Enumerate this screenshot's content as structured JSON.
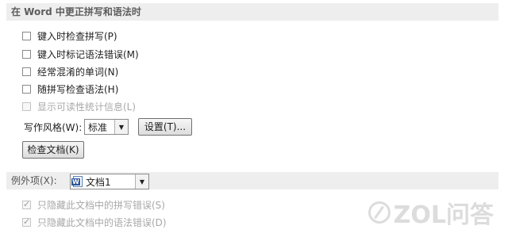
{
  "grammar_section": {
    "title": "在 Word 中更正拼写和语法时",
    "options": [
      {
        "label": "键入时检查拼写(P)",
        "checked": false,
        "disabled": false
      },
      {
        "label": "键入时标记语法错误(M)",
        "checked": false,
        "disabled": false
      },
      {
        "label": "经常混淆的单词(N)",
        "checked": false,
        "disabled": false
      },
      {
        "label": "随拼写检查语法(H)",
        "checked": false,
        "disabled": false
      },
      {
        "label": "显示可读性统计信息(L)",
        "checked": false,
        "disabled": true
      }
    ],
    "writing_style_label": "写作风格(W):",
    "writing_style_value": "标准",
    "settings_button": "设置(T)...",
    "check_document_button": "检查文档(K)"
  },
  "exceptions_section": {
    "title": "例外项(X):",
    "document_value": "文档1",
    "options": [
      {
        "label": "只隐藏此文档中的拼写错误(S)",
        "checked": true,
        "disabled": true
      },
      {
        "label": "只隐藏此文档中的语法错误(D)",
        "checked": true,
        "disabled": true
      }
    ]
  },
  "watermark": {
    "text": "ZOL问答"
  },
  "colors": {
    "header_bg": "#eeeeee",
    "disabled_text": "#a8a8a8"
  }
}
